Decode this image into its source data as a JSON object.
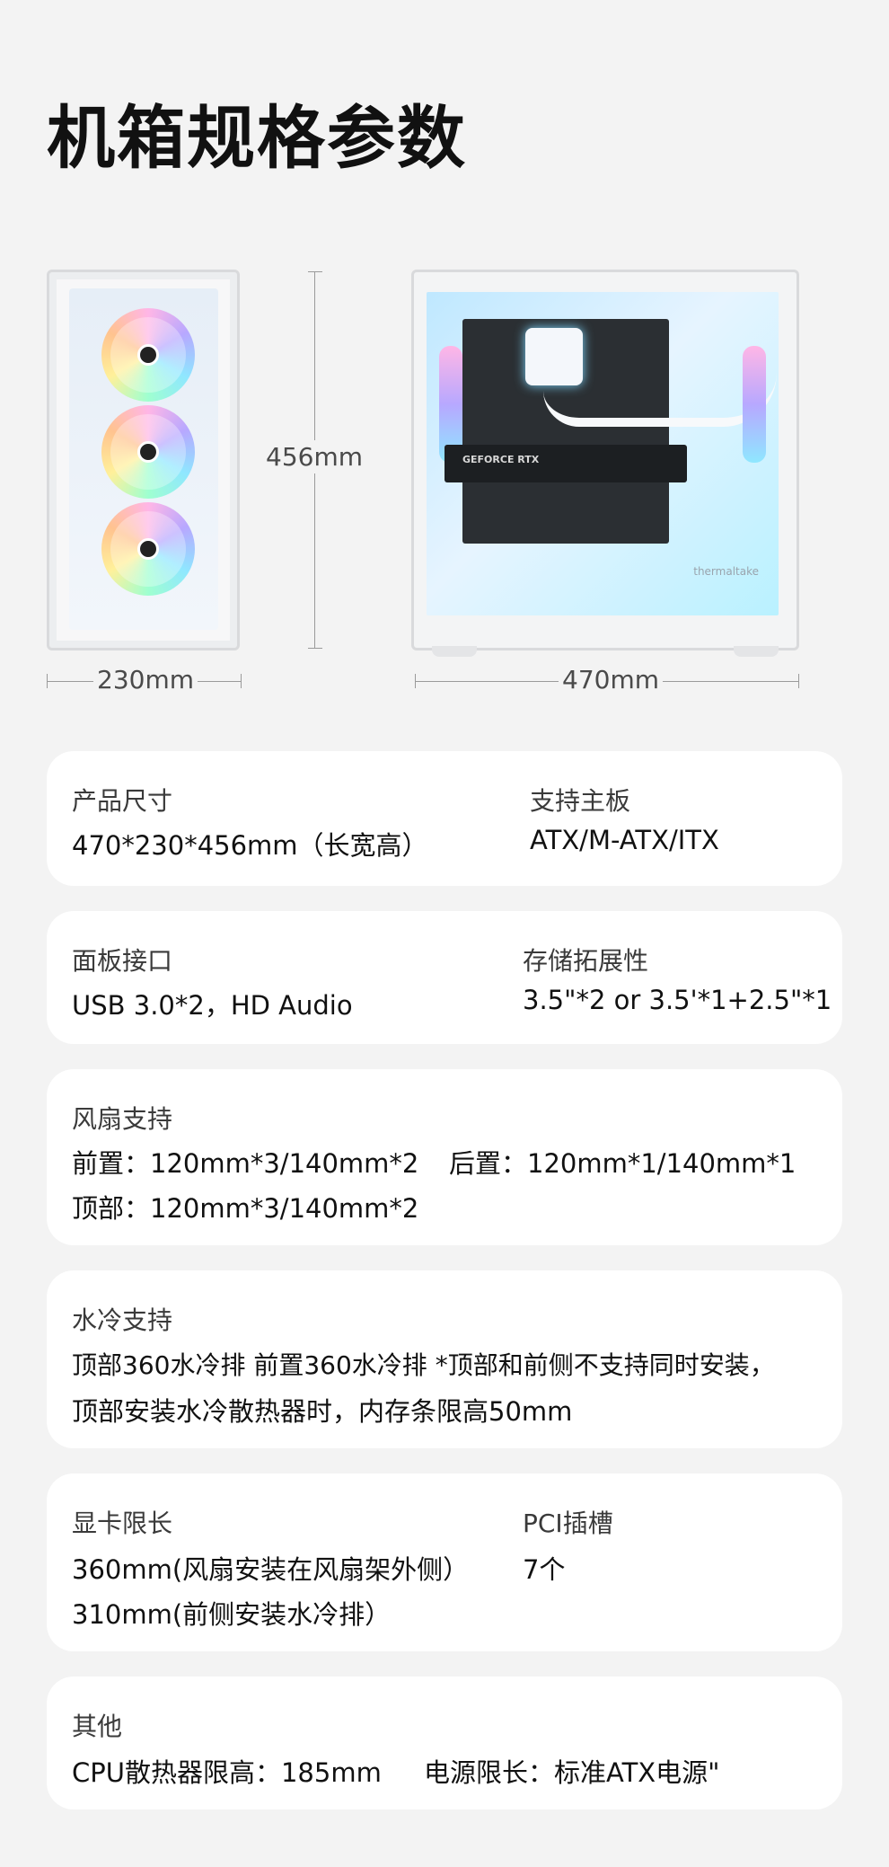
{
  "title": "机箱规格参数",
  "dimensions": {
    "height_label": "456mm",
    "width_label": "230mm",
    "length_label": "470mm",
    "gpu_text": "GEFORCE RTX",
    "brand_text": "thermaltake"
  },
  "specs": {
    "size": {
      "label": "产品尺寸",
      "value": "470*230*456mm（长宽高）"
    },
    "motherboard": {
      "label": "支持主板",
      "value": "ATX/M-ATX/ITX"
    },
    "panel": {
      "label": "面板接口",
      "value": "USB 3.0*2，HD Audio"
    },
    "storage": {
      "label": "存储拓展性",
      "value": "3.5\"*2 or 3.5'*1+2.5\"*1"
    },
    "fan": {
      "label": "风扇支持",
      "front": "前置：120mm*3/140mm*2",
      "rear": "后置：120mm*1/140mm*1",
      "top": "顶部：120mm*3/140mm*2"
    },
    "water": {
      "label": "水冷支持",
      "line1": "顶部360水冷排   前置360水冷排 *顶部和前侧不支持同时安装，",
      "line2": "顶部安装水冷散热器时，内存条限高50mm"
    },
    "gpu": {
      "label": "显卡限长",
      "line1": "360mm(风扇安装在风扇架外侧）",
      "line2": "310mm(前侧安装水冷排）"
    },
    "pci": {
      "label": "PCI插槽",
      "value": "7个"
    },
    "other": {
      "label": "其他",
      "cpu": "CPU散热器限高：185mm",
      "psu": "电源限长：标准ATX电源\""
    }
  }
}
